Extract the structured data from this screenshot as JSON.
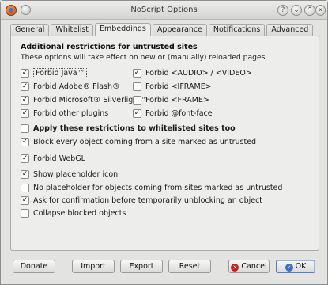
{
  "window": {
    "title": "NoScript Options",
    "buttons": {
      "help": "?",
      "minimize": "⌄",
      "maximize": "⌃",
      "close": "×"
    }
  },
  "tabs": [
    {
      "label": "General"
    },
    {
      "label": "Whitelist"
    },
    {
      "label": "Embeddings",
      "active": true
    },
    {
      "label": "Appearance"
    },
    {
      "label": "Notifications"
    },
    {
      "label": "Advanced"
    }
  ],
  "embeddings": {
    "heading": "Additional restrictions for untrusted sites",
    "note": "These options will take effect on new or (manually) reloaded pages",
    "left_options": [
      {
        "label": "Forbid Java™",
        "checked": true
      },
      {
        "label": "Forbid Adobe® Flash®",
        "checked": true
      },
      {
        "label": "Forbid Microsoft® Silverlight™",
        "checked": true
      },
      {
        "label": "Forbid other plugins",
        "checked": true
      }
    ],
    "right_options": [
      {
        "label": "Forbid <AUDIO> / <VIDEO>",
        "checked": true
      },
      {
        "label": "Forbid <IFRAME>",
        "checked": false
      },
      {
        "label": "Forbid <FRAME>",
        "checked": false
      },
      {
        "label": "Forbid @font-face",
        "checked": true
      }
    ],
    "apply_whitelisted": {
      "label": "Apply these restrictions to whitelisted sites too",
      "checked": false
    },
    "block_untrusted": {
      "label": "Block every object coming from a site marked as untrusted",
      "checked": true
    },
    "forbid_webgl": {
      "label": "Forbid WebGL",
      "checked": true
    },
    "show_placeholder": {
      "label": "Show placeholder icon",
      "checked": true
    },
    "no_placeholder_untrusted": {
      "label": "No placeholder for objects coming from sites marked as untrusted",
      "checked": false
    },
    "ask_confirmation": {
      "label": "Ask for confirmation before temporarily unblocking an object",
      "checked": true
    },
    "collapse_blocked": {
      "label": "Collapse blocked objects",
      "checked": false
    }
  },
  "footer": {
    "donate": "Donate",
    "import": "Import",
    "export": "Export",
    "reset": "Reset",
    "cancel": "Cancel",
    "ok": "OK"
  },
  "colors": {
    "window_bg": "#e3e3e1",
    "panel_bg": "#ededeb",
    "accent": "#4f7ec6",
    "cancel_icon": "#c81e1e"
  }
}
